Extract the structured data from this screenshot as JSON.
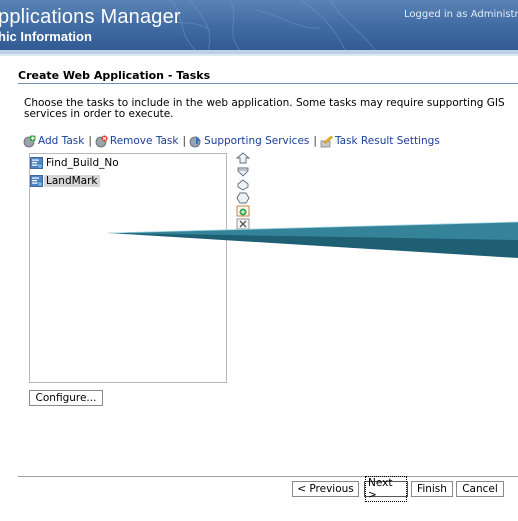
{
  "header": {
    "app_title": "pplications Manager",
    "app_subtitle": "hic Information",
    "logged_in": "Logged in as Administrat"
  },
  "page": {
    "heading": "Create Web Application - Tasks",
    "description": "Choose the tasks to include in the web application. Some tasks may require supporting GIS services in order to execute."
  },
  "toolbar": {
    "add_task": "Add Task",
    "remove_task": "Remove Task",
    "supporting_services": "Supporting Services",
    "task_result_settings": "Task Result Settings",
    "separator": "|"
  },
  "tasks": [
    {
      "label": "Find_Build_No",
      "selected": false
    },
    {
      "label": "LandMark",
      "selected": true
    }
  ],
  "order_controls": [
    "move-to-top-icon",
    "move-up-icon",
    "move-down-icon",
    "move-to-bottom-icon",
    "add-item-icon",
    "delete-item-icon"
  ],
  "buttons": {
    "configure": "Configure...",
    "previous": "< Previous",
    "next": "Next >",
    "finish": "Finish",
    "cancel": "Cancel"
  },
  "colors": {
    "banner": "#3f6aa2",
    "link": "#1a3f9a",
    "callout": "#2d6f82"
  }
}
